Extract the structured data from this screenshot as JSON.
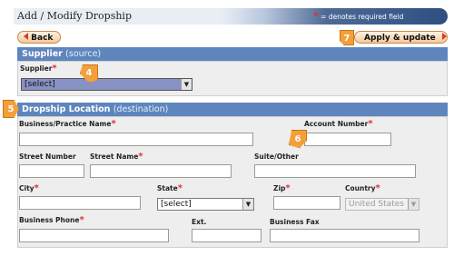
{
  "header": {
    "title": "Add / Modify Dropship",
    "required_star": "*",
    "required_note": "= denotes required field"
  },
  "toolbar": {
    "back_label": "Back",
    "apply_label": "Apply & update"
  },
  "supplier_section": {
    "title": "Supplier",
    "subtitle": "(source)",
    "supplier_label": "Supplier",
    "supplier_value": "[select]"
  },
  "dropship_section": {
    "title": "Dropship Location",
    "subtitle": "(destination)",
    "business_name_label": "Business/Practice Name",
    "account_number_label": "Account Number",
    "street_number_label": "Street Number",
    "street_name_label": "Street Name",
    "suite_label": "Suite/Other",
    "city_label": "City",
    "state_label": "State",
    "state_value": "[select]",
    "zip_label": "Zip",
    "country_label": "Country",
    "country_value": "United States",
    "business_phone_label": "Business Phone",
    "ext_label": "Ext.",
    "business_fax_label": "Business Fax"
  },
  "callouts": {
    "c4": "4",
    "c5": "5",
    "c6": "6",
    "c7": "7"
  },
  "required_mark": "*",
  "colors": {
    "section_bar": "#5e86bd",
    "required_star": "#e23030",
    "callout": "#f4a03a",
    "button_gradient_bottom": "#f3c89c"
  }
}
